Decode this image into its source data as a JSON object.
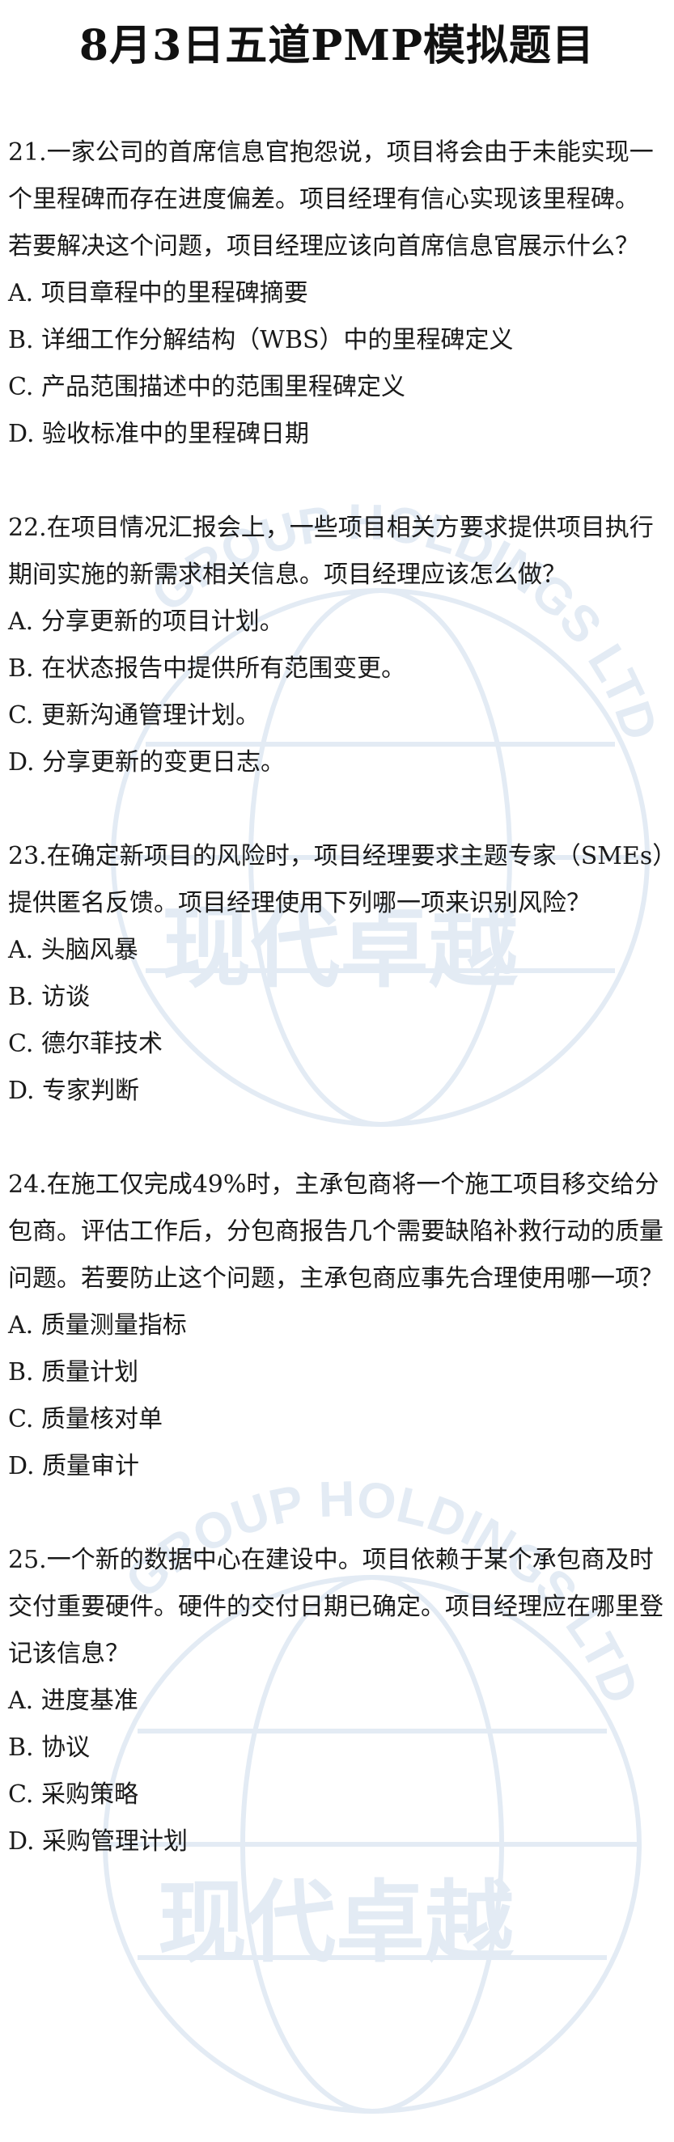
{
  "title": "8月3日五道PMP模拟题目",
  "watermark": {
    "arc_text": "GROUP HOLDINGS LTD",
    "brand": "现代卓越",
    "color": "#dfe8f2"
  },
  "questions": [
    {
      "text": "21.一家公司的首席信息官抱怨说，项目将会由于未能实现一个里程碑而存在进度偏差。项目经理有信心实现该里程碑。",
      "text2": "若要解决这个问题，项目经理应该向首席信息官展示什么？",
      "options": [
        "A. 项目章程中的里程碑摘要",
        "B. 详细工作分解结构（WBS）中的里程碑定义",
        "C. 产品范围描述中的范围里程碑定义",
        "D. 验收标准中的里程碑日期"
      ]
    },
    {
      "text": "22.在项目情况汇报会上，一些项目相关方要求提供项目执行期间实施的新需求相关信息。项目经理应该怎么做？",
      "options": [
        "A. 分享更新的项目计划。",
        "B. 在状态报告中提供所有范围变更。",
        "C. 更新沟通管理计划。",
        "D. 分享更新的变更日志。"
      ]
    },
    {
      "text": "23.在确定新项目的风险时，项目经理要求主题专家（SMEs）提供匿名反馈。项目经理使用下列哪一项来识别风险？",
      "options": [
        "A. 头脑风暴",
        "B. 访谈",
        "C. 德尔菲技术",
        "D. 专家判断"
      ]
    },
    {
      "text": "24.在施工仅完成49%时，主承包商将一个施工项目移交给分包商。评估工作后，分包商报告几个需要缺陷补救行动的质量问题。若要防止这个问题，主承包商应事先合理使用哪一项？",
      "options": [
        "A. 质量测量指标",
        "B. 质量计划",
        "C. 质量核对单",
        "D. 质量审计"
      ]
    },
    {
      "text": "25.一个新的数据中心在建设中。项目依赖于某个承包商及时交付重要硬件。硬件的交付日期已确定。项目经理应在哪里登记该信息？",
      "options": [
        "A. 进度基准",
        "B. 协议",
        "C. 采购策略",
        "D. 采购管理计划"
      ]
    }
  ]
}
